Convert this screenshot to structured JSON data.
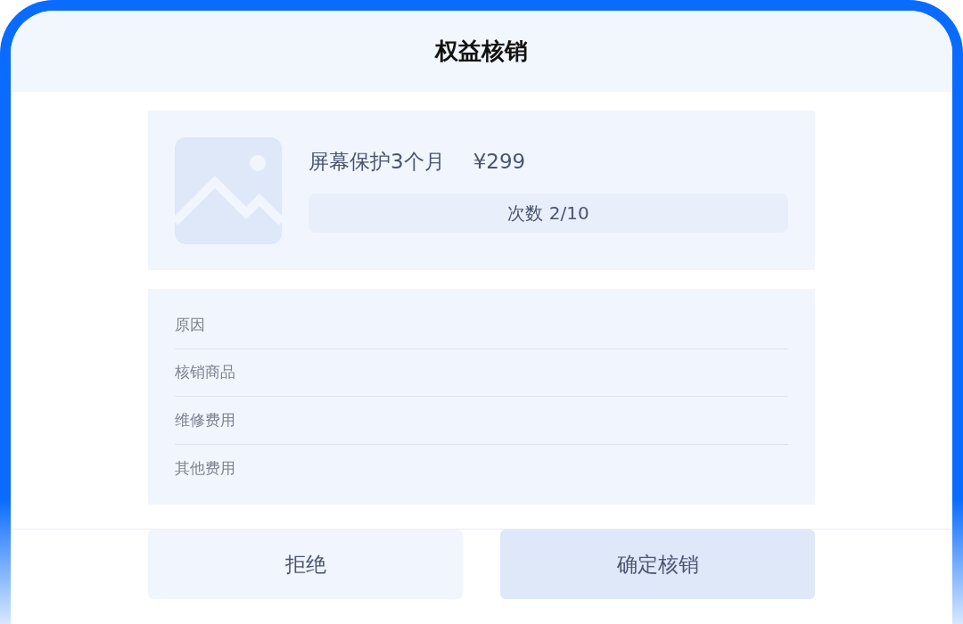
{
  "title": "权益核销",
  "product": {
    "name": "屏幕保护3个月",
    "price": "¥299",
    "usage": "次数 2/10"
  },
  "fields": [
    {
      "label": "原因"
    },
    {
      "label": "核销商品"
    },
    {
      "label": "维修费用"
    },
    {
      "label": "其他费用"
    }
  ],
  "buttons": [
    {
      "label": "拒绝",
      "kind": "secondary"
    },
    {
      "label": "确定核销",
      "kind": "primary"
    }
  ]
}
